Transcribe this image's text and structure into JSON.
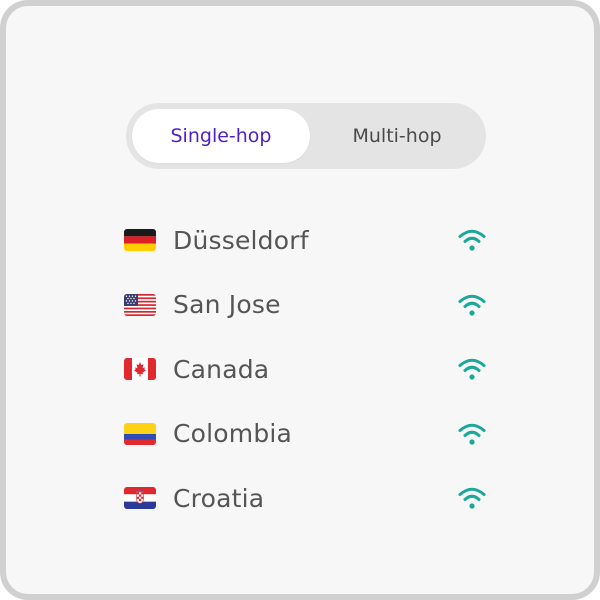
{
  "tabs": {
    "active_label": "Single-hop",
    "inactive_label": "Multi-hop"
  },
  "locations": [
    {
      "name": "Düsseldorf",
      "flag": "germany-flag-icon"
    },
    {
      "name": "San Jose",
      "flag": "usa-flag-icon"
    },
    {
      "name": "Canada",
      "flag": "canada-flag-icon"
    },
    {
      "name": "Colombia",
      "flag": "colombia-flag-icon"
    },
    {
      "name": "Croatia",
      "flag": "croatia-flag-icon"
    }
  ],
  "colors": {
    "accent": "#4f1fc8",
    "signal": "#1aa89a",
    "text": "#555555"
  }
}
